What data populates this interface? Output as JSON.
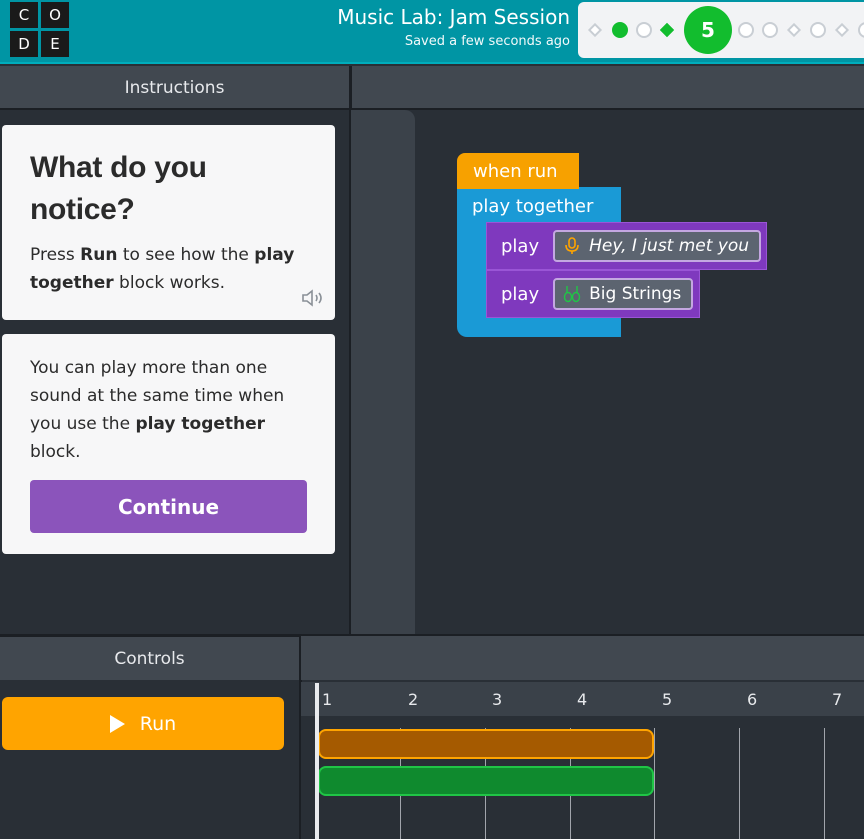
{
  "header": {
    "logo_letters": [
      "C",
      "O",
      "D",
      "E"
    ],
    "title": "Music Lab: Jam Session",
    "save_status": "Saved a few seconds ago",
    "current_level": "5",
    "colors": {
      "bar": "#0095a4",
      "done": "#12bd2e"
    }
  },
  "instructions": {
    "panel_label": "Instructions",
    "card1": {
      "title": "What do you notice?",
      "text_pre": "Press ",
      "text_bold1": "Run",
      "text_mid": " to see how the ",
      "text_bold2": "play together",
      "text_post": " block works.",
      "speaker_icon": "speaker-icon"
    },
    "card2": {
      "text_pre": "You can play more than one sound at the same time when you use the ",
      "text_bold": "play together",
      "text_post": " block.",
      "continue_label": "Continue"
    }
  },
  "workspace": {
    "blocks": {
      "when_run": "when run",
      "play_together": "play together",
      "play_label": "play",
      "sound1": {
        "name": "Hey, I just met you",
        "icon": "microphone-icon"
      },
      "sound2": {
        "name": "Big Strings",
        "icon": "strings-instrument-icon"
      }
    },
    "colors": {
      "event": "#f7a100",
      "together": "#1a9ad6",
      "play": "#7f39be"
    }
  },
  "controls": {
    "panel_label": "Controls",
    "run_label": "Run",
    "run_icon": "play-icon"
  },
  "timeline": {
    "ticks": [
      "1",
      "2",
      "3",
      "4",
      "5",
      "6",
      "7"
    ],
    "colors": {
      "sound1": "#ffa400",
      "sound2": "#20c546"
    }
  }
}
